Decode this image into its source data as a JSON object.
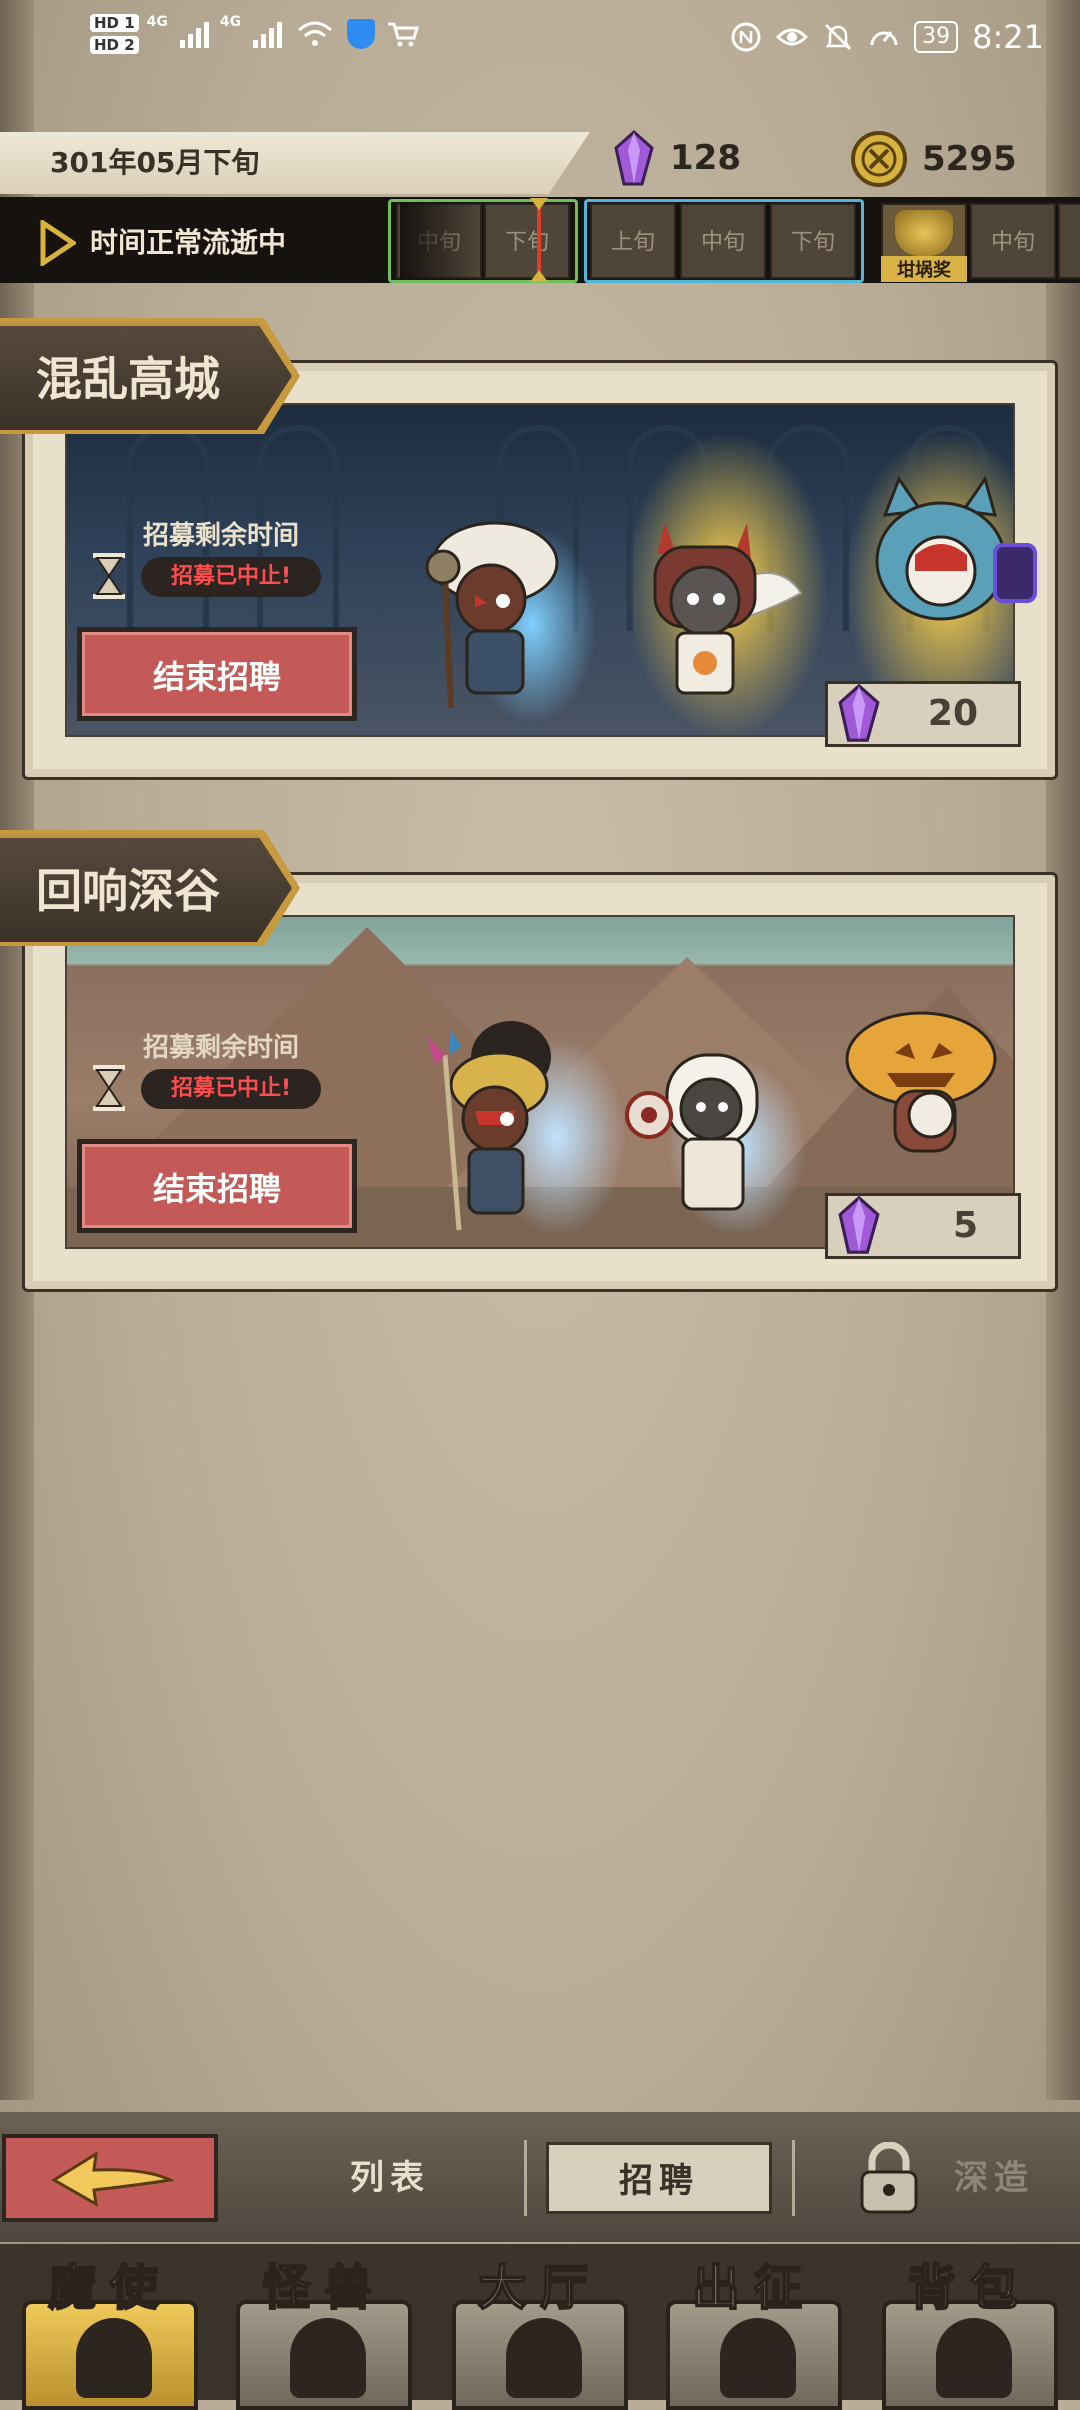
{
  "status_bar": {
    "hd1": "HD 1",
    "hd2": "HD 2",
    "net1": "4G",
    "net2": "4G",
    "battery": "39",
    "time": "8:21"
  },
  "header": {
    "date": "301年05月下旬",
    "crystals": "128",
    "coins": "5295"
  },
  "timeline": {
    "status": "时间正常流逝中",
    "segments_prev": [
      "中旬",
      "下旬"
    ],
    "segments_next": [
      "上旬",
      "中旬",
      "下旬"
    ],
    "reward_label": "坩埚奖",
    "segment_after": "中旬"
  },
  "recruit_cards": [
    {
      "title": "混乱高城",
      "remaining_label": "招募剩余时间",
      "stopped_text": "招募已中止!",
      "end_button": "结束招聘",
      "cost": "20"
    },
    {
      "title": "回响深谷",
      "remaining_label": "招募剩余时间",
      "stopped_text": "招募已中止!",
      "end_button": "结束招聘",
      "cost": "5"
    }
  ],
  "tabs": {
    "list": "列表",
    "recruit": "招聘",
    "forge": "深造"
  },
  "bottom_nav": [
    "魔使",
    "怪兽",
    "大厅",
    "出征",
    "背包"
  ],
  "colors": {
    "button_red": "#c45a57",
    "stopped_red": "#ff4d4d",
    "crystal_purple": "#a05ad8",
    "coin_gold": "#d8b23e",
    "frame_green": "#6fbf5a",
    "frame_cyan": "#4fb8d8"
  },
  "icons": {
    "crystal": "crystal-icon",
    "coin": "coin-icon",
    "play": "play-icon",
    "hourglass": "hourglass-icon",
    "back": "back-arrow-icon",
    "lock": "lock-icon"
  }
}
